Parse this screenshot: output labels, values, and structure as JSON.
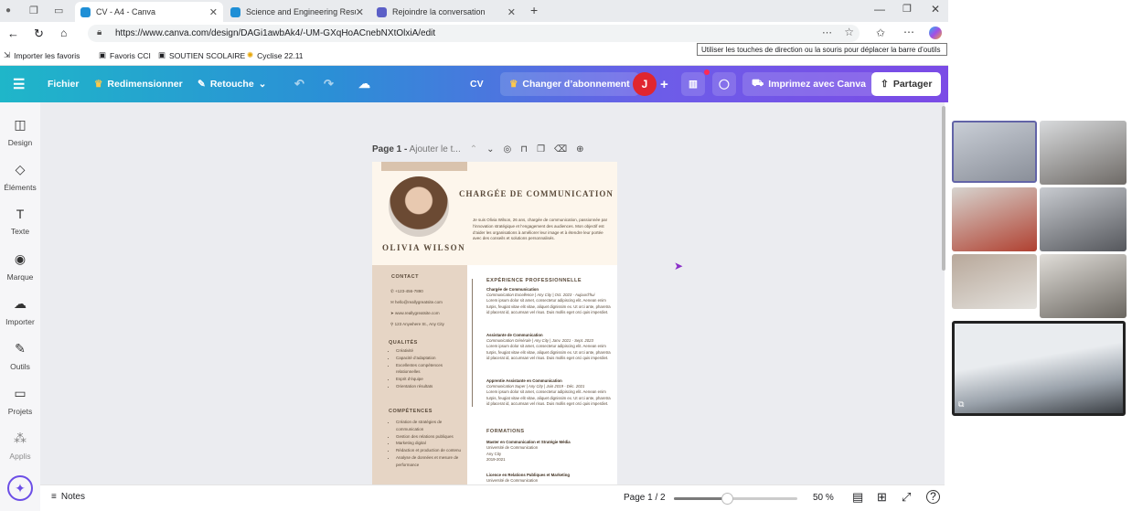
{
  "browser": {
    "tabs": [
      {
        "label": "CV - A4 - Canva"
      },
      {
        "label": "Science and Engineering Resume"
      },
      {
        "label": "Rejoindre la conversation"
      }
    ],
    "url": "https://www.canva.com/design/DAGi1awbAk4/-UM-GXqHoACnebNXtOlxiA/edit",
    "bookmarks": [
      "Importer les favoris",
      "Favoris CCI",
      "SOUTIEN SCOLAIRE",
      "Cyclise 22.11"
    ],
    "tooltip": "Utiliser les touches de direction ou la souris pour déplacer la barre d’outils"
  },
  "toolbar": {
    "file": "Fichier",
    "resize": "Redimensionner",
    "retouch": "Retouche",
    "doc_name": "CV",
    "upgrade": "Changer d’abonnement",
    "avatar": "J",
    "print": "Imprimez avec Canva",
    "share": "Partager"
  },
  "rail": [
    "Design",
    "Éléments",
    "Texte",
    "Marque",
    "Importer",
    "Outils",
    "Projets",
    "Applis"
  ],
  "page": {
    "label": "Page 1 -",
    "placeholder": "Ajouter le t..."
  },
  "cv": {
    "title": "CHARGÉE DE COMMUNICATION",
    "name": "OLIVIA WILSON",
    "intro": "Je suis Olivia Wilson, 26 ans, chargée de communication, passionnée par l’innovation stratégique et l’engagement des audiences. Mon objectif est d’aider les organisations à améliorer leur image et à étendre leur portée avec des conseils et solutions personnalisés.",
    "contact_h": "CONTACT",
    "contact": [
      "+123-456-7890",
      "hello@reallygreatsite.com",
      "www.reallygreatsite.com",
      "123 Anywhere St., Any City"
    ],
    "qual_h": "QUALITÉS",
    "qualities": [
      "Créativité",
      "Capacité d’adaptation",
      "Excellentes compétences relationnelles",
      "Esprit d’équipe",
      "Orientation résultats"
    ],
    "comp_h": "COMPÉTENCES",
    "competences": [
      "Création de stratégies de communication",
      "Gestion des relations publiques",
      "Marketing digital",
      "Rédaction et production de contenu",
      "Analyse de données et mesure de performance"
    ],
    "exp_h": "EXPÉRIENCE PROFESSIONNELLE",
    "jobs": [
      {
        "title": "Chargée de Communication",
        "sub": "Communication Excellence | Any City | Oct. 2023 - Aujourd’hui"
      },
      {
        "title": "Assistante de Communication",
        "sub": "Communication Générale | Any City | Janv. 2021 - Sept. 2023"
      },
      {
        "title": "Apprentie Assistante en Communication",
        "sub": "Communication Super | Any City | Juin 2019 - Déc. 2021"
      }
    ],
    "lorem": "Lorem ipsum dolor sit amet, consectetur adipiscing elit. Aenean enim turpis, feugiat vitae elit vitae, aliquet dignissim ex. Ut orci ante, pharetra id placerat id, accumsan vel risus. Duis mollis eget orci quis imperdiet.",
    "form_h": "FORMATIONS",
    "forms": [
      {
        "title": "Master en Communication et Stratégie Média",
        "l1": "Université de Communication",
        "l2": "Any City",
        "l3": "2019-2021"
      },
      {
        "title": "Licence en Relations Publiques et Marketing",
        "l1": "Université de Communication",
        "l2": "",
        "l3": ""
      }
    ]
  },
  "bottom": {
    "notes": "Notes",
    "pages": "Page 1 / 2",
    "zoom": "50 %",
    "zoom_fraction": 0.5
  }
}
